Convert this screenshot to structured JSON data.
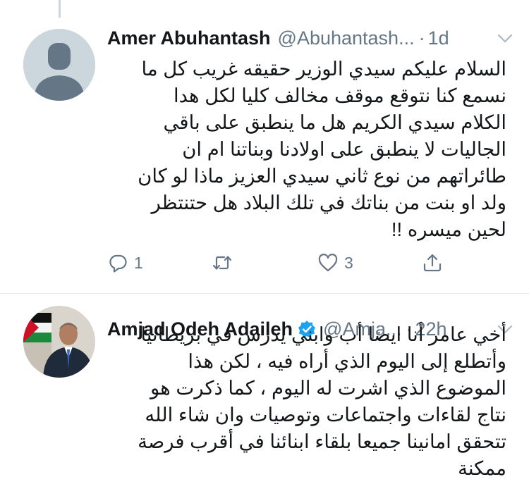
{
  "tweets": [
    {
      "display_name": "Amer Abuhantash",
      "handle": "@Abuhantash...",
      "separator": "·",
      "time": "1d",
      "text": "السلام عليكم سيدي الوزير حقيقه غريب كل ما\nنسمع كنا نتوقع موقف مخالف كليا لكل هدا\nالكلام سيدي الكريم هل ما ينطبق على باقي\nالجاليات لا ينطبق على اولادنا وبناتنا ام ان\nطائراتهم من نوع ثاني سيدي العزيز ماذا لو كان\nولد او بنت من بناتك في تلك البلاد هل حتنتظر\nلحين ميسره !!",
      "reply_count": "1",
      "retweet_count": "",
      "like_count": "3",
      "avatar": "default-avatar-icon"
    },
    {
      "display_name": "Amjad Odeh Adaileh",
      "handle": "@Amja...",
      "separator": "·",
      "time": "22h",
      "verified": true,
      "text": "أخي عامر أنا ايضا أب وابني يدرس في بريطانيا\nوأتطلع إلى اليوم الذي أراه فيه ، لكن هذا\nالموضوع الذي اشرت له اليوم ، كما ذكرت هو\nنتاج لقاءات واجتماعات وتوصيات وان شاء الله\nتتحقق امانينا جميعا بلقاء ابنائنا في أقرب فرصة\nممكنة",
      "avatar": "profile-photo"
    }
  ],
  "colors": {
    "text": "#14171a",
    "secondary": "#657786",
    "verified": "#1da1f2",
    "divider": "#e6ecf0",
    "avatar_placeholder": "#ccd6dd"
  }
}
